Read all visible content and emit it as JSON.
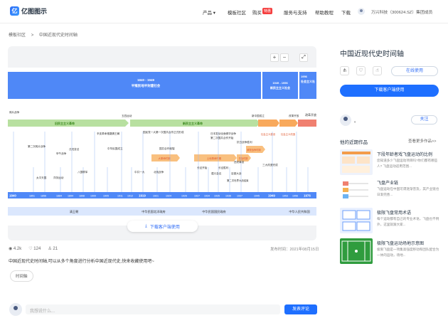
{
  "nav": {
    "logo_mark": "亿",
    "logo": "亿图图示",
    "items": [
      "产品 ▾",
      "模板社区",
      "购买 ▾",
      "服务与支持",
      "帮助教程",
      "下载"
    ],
    "badge": "特惠",
    "company": "万兴科技（300624.SZ）集团成员"
  },
  "breadcrumb": [
    "模板社区",
    ">",
    "中国近现代史时间轴"
  ],
  "timeline": {
    "header_blocks": [
      {
        "title": "1840 - 1949",
        "sub": "半殖民地半封建社会"
      },
      {
        "title": "1949 - 1956",
        "sub": "新民主主义社会"
      },
      {
        "title": "1956",
        "sub": "社会主义社"
      }
    ],
    "phases": [
      "旧民主主义革命",
      "新民主主义革命",
      "社会主义建设",
      "社会主义改造",
      "改革开放"
    ],
    "years": [
      "1840",
      "1851",
      "1856",
      "1884",
      "1894",
      "1898",
      "1900",
      "1905",
      "1911",
      "1912",
      "1919",
      "1921",
      "1924",
      "1926",
      "1927",
      "1934",
      "1935",
      "1936",
      "1937",
      "1945",
      "1949",
      "1953",
      "1956",
      "1976"
    ],
    "upper_events": [
      "鸦片战争",
      "第二次鸦片战争",
      "甲午战争",
      "戊戌变法",
      "辛亥革命推翻清王朝",
      "中华民国成立",
      "五四运动",
      "国民党一大第一次国共合作正式形成",
      "国共合作破裂",
      "日本发动全面侵华战争",
      "第二次国共合作开始",
      "抗日战争胜利",
      "新中国成立",
      "改革开放"
    ],
    "lower_events": [
      "太平天国",
      "洋务运动",
      "八国联军",
      "中共一大",
      "北伐战争",
      "长征开始",
      "遵义会议",
      "长征胜利",
      "西安事变",
      "百团大战",
      "第二次世界大战结束",
      "三大改造完成"
    ],
    "arrow_labels": [
      "大革命时期",
      "土地革命时期",
      "抗战时期",
      "解放战争时期"
    ],
    "eras": [
      "清王朝",
      "中华民国北洋政府",
      "中华民国国民政府",
      "中华人民共和国"
    ],
    "download_label": "下载客户端使用"
  },
  "stats": {
    "views": "4.2k",
    "likes": "124",
    "shares": "21",
    "published": "发布时间：2021年08月15日"
  },
  "description": "中国近现代史时间轴,可以从多个角度进行分析中国近现代史,快来收藏使用吧~",
  "tag": "时间轴",
  "comment": {
    "placeholder": "我想说什么...",
    "submit": "发表评论"
  },
  "sidebar": {
    "title": "中国近现代史时间轴",
    "online": "在线使用",
    "download": "下载客户端使用",
    "author": "。",
    "follow": "关注",
    "works_title": "他的近期作品",
    "more": "查看更多作品>>",
    "works": [
      {
        "title": "下段年龄者戏飞盘运动的比例",
        "desc": "您知道多少飞盘运动项目吗?你们都有哪些人? 飞盘运动适用范围..."
      },
      {
        "title": "飞盘产业链",
        "desc": "飞盘运动在中国可谓逐渐普及，其产业链也日渐完善..."
      },
      {
        "title": "极限飞盘常用术语",
        "desc": "每个运动都有自己的专业术语，飞盘也不例外，这里就跟大家..."
      },
      {
        "title": "极限飞盘运动场地示意图",
        "desc": "极限飞盘是一项集高强度移动和团队配合为一体的运动，场地..."
      }
    ]
  },
  "colors": {
    "accent": "#1e6fff",
    "header": "#4f88f7",
    "green": "#a8d98a",
    "orange": "#f8a95c",
    "red": "#f08070"
  }
}
